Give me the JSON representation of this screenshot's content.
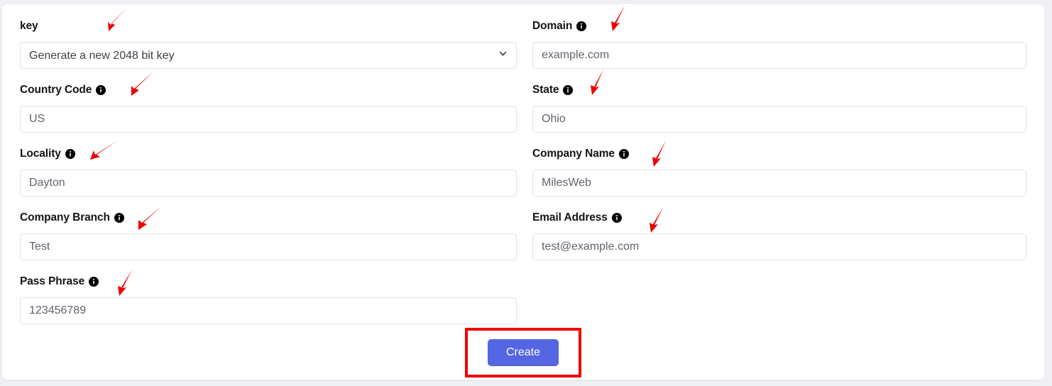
{
  "form": {
    "fields": [
      {
        "id": "key",
        "label": "key",
        "has_info_icon": false,
        "type": "select",
        "value": "Generate a new 2048 bit key",
        "column": "left"
      },
      {
        "id": "domain",
        "label": "Domain",
        "has_info_icon": true,
        "type": "text",
        "value": "example.com",
        "placeholder": "example.com",
        "column": "right"
      },
      {
        "id": "country-code",
        "label": "Country Code",
        "has_info_icon": true,
        "type": "text",
        "value": "US",
        "placeholder": "US",
        "column": "left"
      },
      {
        "id": "state",
        "label": "State",
        "has_info_icon": true,
        "type": "text",
        "value": "Ohio",
        "placeholder": "Ohio",
        "column": "right"
      },
      {
        "id": "locality",
        "label": "Locality",
        "has_info_icon": true,
        "type": "text",
        "value": "Dayton",
        "placeholder": "Dayton",
        "column": "left"
      },
      {
        "id": "company-name",
        "label": "Company Name",
        "has_info_icon": true,
        "type": "text",
        "value": "MilesWeb",
        "placeholder": "MilesWeb",
        "column": "right"
      },
      {
        "id": "company-branch",
        "label": "Company Branch",
        "has_info_icon": true,
        "type": "text",
        "value": "Test",
        "placeholder": "Test",
        "column": "left"
      },
      {
        "id": "email-address",
        "label": "Email Address",
        "has_info_icon": true,
        "type": "text",
        "value": "test@example.com",
        "placeholder": "test@example.com",
        "column": "right"
      },
      {
        "id": "pass-phrase",
        "label": "Pass Phrase",
        "has_info_icon": true,
        "type": "text",
        "value": "123456789",
        "placeholder": "123456789",
        "column": "left"
      }
    ],
    "submit_label": "Create"
  },
  "icons": {
    "info": "info-circle-icon",
    "chevron": "chevron-down-icon",
    "arrow": "annotation-arrow-icon"
  },
  "colors": {
    "page_background": "#eef0f4",
    "card_background": "#ffffff",
    "label_text": "#111318",
    "input_text": "#5f646e",
    "input_border": "#dfe1e6",
    "button_background": "#5566e2",
    "button_text": "#ffffff",
    "annotation_red": "#ee0000"
  },
  "annotations": {
    "arrow_count": 9,
    "highlight_target": "Create"
  }
}
